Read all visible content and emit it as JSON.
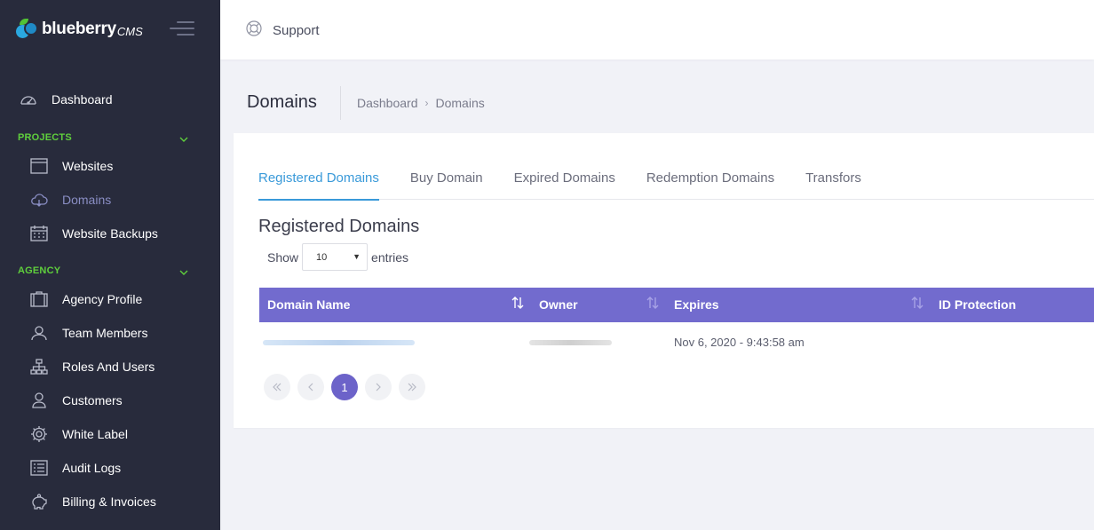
{
  "brand": {
    "name": "blueberry",
    "suffix": "CMS"
  },
  "topbar": {
    "support_label": "Support"
  },
  "sidebar": {
    "dashboard_label": "Dashboard",
    "sections": [
      {
        "title": "PROJECTS"
      },
      {
        "title": "AGENCY"
      }
    ],
    "projects": [
      "Websites",
      "Domains",
      "Website Backups"
    ],
    "agency": [
      "Agency Profile",
      "Team Members",
      "Roles And Users",
      "Customers",
      "White Label",
      "Audit Logs",
      "Billing & Invoices"
    ]
  },
  "page": {
    "title": "Domains",
    "breadcrumb": [
      "Dashboard",
      "Domains"
    ]
  },
  "tabs": [
    "Registered Domains",
    "Buy Domain",
    "Expired Domains",
    "Redemption Domains",
    "Transfors"
  ],
  "section_heading": "Registered Domains",
  "length_menu": {
    "show": "Show",
    "value": "10",
    "entries": "entries"
  },
  "table": {
    "columns": [
      "Domain Name",
      "Owner",
      "Expires",
      "ID Protection"
    ],
    "rows": [
      {
        "domain": "",
        "owner": "",
        "expires": "Nov 6, 2020 - 9:43:58 am",
        "id_protection": ""
      }
    ]
  },
  "pagination": {
    "current": "1"
  },
  "colors": {
    "sidebar_bg": "#282b3c",
    "accent_green": "#5fcf3c",
    "table_header": "#726bce",
    "tab_active": "#3a9ad9"
  }
}
